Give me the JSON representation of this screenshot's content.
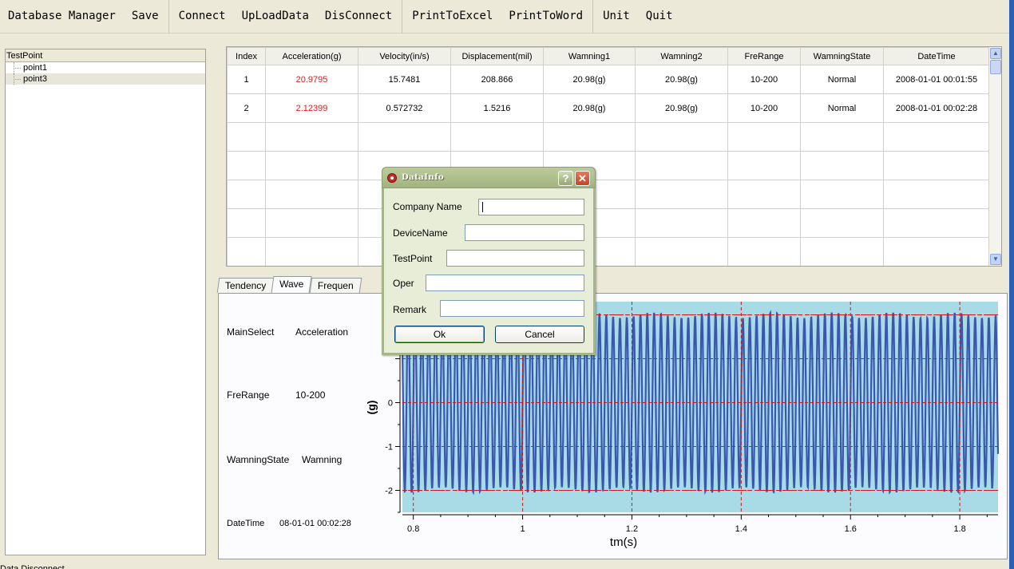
{
  "menu": [
    "Database Manager",
    "Save",
    "Connect",
    "UpLoadData",
    "DisConnect",
    "PrintToExcel",
    "PrintToWord",
    "Unit",
    "Quit"
  ],
  "tree": {
    "header": "TestPoint",
    "nodes": [
      "point1",
      "point3"
    ],
    "selected": "point3"
  },
  "grid": {
    "columns": [
      "Index",
      "Acceleration(g)",
      "Velocity(in/s)",
      "Displacement(mil)",
      "Wamning1",
      "Wamning2",
      "FreRange",
      "WamningState",
      "DateTime"
    ],
    "rows": [
      [
        "1",
        "20.9795",
        "15.7481",
        "208.866",
        "20.98(g)",
        "20.98(g)",
        "10-200",
        "Normal",
        "2008-01-01 00:01:55"
      ],
      [
        "2",
        "2.12399",
        "0.572732",
        "1.5216",
        "20.98(g)",
        "20.98(g)",
        "10-200",
        "Normal",
        "2008-01-01 00:02:28"
      ]
    ],
    "empty_rows": 5,
    "alert_color": "#e8181c"
  },
  "tabs": [
    "Tendency",
    "Wave",
    "Frequen"
  ],
  "active_tab": "Wave",
  "info": {
    "mainselect_label": "MainSelect",
    "mainselect_value": "Acceleration",
    "frerange_label": "FreRange",
    "frerange_value": "10-200",
    "state_label": "WamningState",
    "state_value": "Wamning",
    "datetime_label": "DateTime",
    "datetime_value": "08-01-01 00:02:28"
  },
  "chart_data": {
    "type": "line",
    "xlabel": "tm(s)",
    "ylabel": "(g)",
    "xlim": [
      0.78,
      1.87
    ],
    "ylim": [
      -2.5,
      2.3
    ],
    "xticks": [
      "0.8",
      "1",
      "1.2",
      "1.4",
      "1.6",
      "1.8"
    ],
    "yticks": [
      "0",
      "-1",
      "-2"
    ],
    "grid": true,
    "background_color": "#a8dbe6",
    "line_color": "#3a56b0",
    "grid_color": "#d01818",
    "warning_lines_y": [
      2.0,
      -2.0
    ],
    "series": [
      {
        "signal": "oscillation",
        "amplitude": 2.05,
        "period_s": 0.0125
      }
    ]
  },
  "dialog": {
    "title": "DataInfo",
    "help_label": "?",
    "close_label": "✕",
    "fields": [
      {
        "label": "Company Name",
        "value": ""
      },
      {
        "label": "DeviceName",
        "value": ""
      },
      {
        "label": "TestPoint",
        "value": ""
      },
      {
        "label": "Oper",
        "value": ""
      },
      {
        "label": "Remark",
        "value": ""
      }
    ],
    "ok_label": "Ok",
    "cancel_label": "Cancel"
  },
  "status": "Data Disconnect"
}
